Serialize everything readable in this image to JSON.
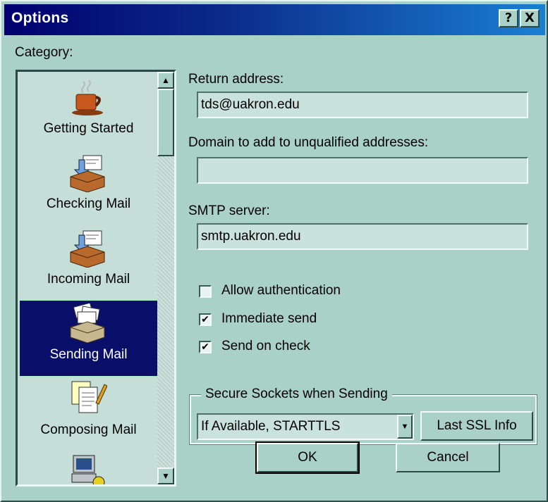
{
  "window": {
    "title": "Options",
    "help_label": "?",
    "close_label": "X"
  },
  "category": {
    "label": "Category:",
    "items": [
      {
        "label": "Getting Started",
        "icon": "coffee-cup-icon"
      },
      {
        "label": "Checking Mail",
        "icon": "mailbox-download-icon"
      },
      {
        "label": "Incoming Mail",
        "icon": "mailbox-incoming-icon"
      },
      {
        "label": "Sending Mail",
        "icon": "sending-mail-icon",
        "selected": true
      },
      {
        "label": "Composing Mail",
        "icon": "composing-mail-icon"
      },
      {
        "label": "",
        "icon": "computer-icon"
      }
    ]
  },
  "form": {
    "return_address_label": "Return address:",
    "return_address_value": "tds@uakron.edu",
    "domain_label": "Domain to add to unqualified addresses:",
    "domain_value": "",
    "smtp_label": "SMTP server:",
    "smtp_value": "smtp.uakron.edu",
    "allow_auth_label": "Allow authentication",
    "allow_auth_checked": false,
    "immediate_send_label": "Immediate send",
    "immediate_send_checked": true,
    "send_on_check_label": "Send on check",
    "send_on_check_checked": true
  },
  "ssl": {
    "group_label": "Secure Sockets when Sending",
    "selected_option": "If Available, STARTTLS",
    "last_ssl_info_label": "Last SSL Info"
  },
  "buttons": {
    "ok": "OK",
    "cancel": "Cancel"
  },
  "colors": {
    "face": "#a9d1c8",
    "titlebar": "#00006e",
    "selection": "#0a0f6a"
  }
}
